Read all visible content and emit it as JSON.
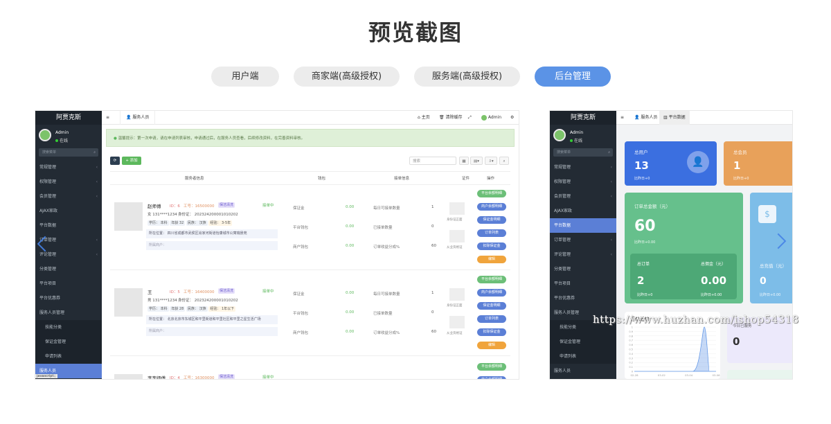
{
  "page_title": "预览截图",
  "tabs": [
    {
      "label": "用户端",
      "active": false
    },
    {
      "label": "商家端(高级授权)",
      "active": false
    },
    {
      "label": "服务端(高级授权)",
      "active": false
    },
    {
      "label": "后台管理",
      "active": true
    }
  ],
  "colors": {
    "accent": "#5b93e6",
    "sidebar": "#232b34",
    "green": "#5cb85c",
    "purple": "#5b7fd6",
    "orange": "#f0a43c"
  },
  "sidebar": {
    "brand": "阿贾克斯",
    "user": "Admin",
    "status": "在线",
    "search_placeholder": "搜索菜单",
    "left_items": [
      "常规管理",
      "权限管理",
      "会员管理",
      "AJAX家政",
      "平台数据",
      "订单管理",
      "评论管理",
      "分类管理",
      "平台项目",
      "平台优惠券",
      "服务人员管理",
      "技能分类",
      "保证金管理",
      "申请列表",
      "服务人员"
    ],
    "right_items": [
      "常规管理",
      "权限管理",
      "会员管理",
      "AJAX家政",
      "平台数据",
      "订单管理",
      "评论管理",
      "分类管理",
      "平台项目",
      "平台优惠券",
      "服务人员管理",
      "技能分类",
      "保证金管理",
      "申请列表",
      "服务人员"
    ]
  },
  "left_screen": {
    "tab": "服务人员",
    "top_links": [
      "主页",
      "清除缓存",
      "Admin"
    ],
    "notice": "温馨提示：第一次申请，请在申请列表审核，申请通过后，在服务人员查看，后续修改资料，在完善资料审核。",
    "add_button": "+ 添加",
    "search_placeholder": "搜索",
    "columns": [
      "服务者信息",
      "钱包",
      "接单信息",
      "证件",
      "操作"
    ],
    "rows": [
      {
        "name": "赵师傅",
        "id": "ID：6",
        "work_no": "工号：16500000",
        "status_tag": "保洁清洗",
        "state": "接单中",
        "gender_phone": "女  131****1234",
        "idcard": "身份证：  2023242000010102​02",
        "edu": "学历：  本科",
        "age": "年龄  32",
        "nation": "民族：  汉族",
        "exp": "经验：  3-5年",
        "address": "所在位置：  四川省成都市武侯区肖家河街道怡康城市公寓瑞景苑",
        "merchant": "所属商户：",
        "wallet": [
          [
            "保证金",
            "0.00"
          ],
          [
            "平台钱包",
            "0.00"
          ],
          [
            "商户钱包",
            "0.00"
          ]
        ],
        "orders": [
          [
            "每日可接单数量",
            "1"
          ],
          [
            "已接单数量",
            "0"
          ],
          [
            "订单收益分成%",
            "60"
          ]
        ],
        "docs": [
          "身份证正面",
          "从业资格证"
        ]
      },
      {
        "name": "王",
        "id": "ID：5",
        "work_no": "工号：16400000",
        "status_tag": "保洁清洗",
        "state": "接单中",
        "gender_phone": "男  131****1234",
        "idcard": "身份证：  2023242000010102​02",
        "edu": "学历：  本科",
        "age": "年龄  28",
        "nation": "民族：  汉族",
        "exp": "经验：  1年以下",
        "address": "所在位置：  北京北京市东城区和平里街道和平里社区和平里之星生活广场",
        "merchant": "所属商户：",
        "wallet": [
          [
            "保证金",
            "0.00"
          ],
          [
            "平台钱包",
            "0.00"
          ],
          [
            "商户钱包",
            "0.00"
          ]
        ],
        "orders": [
          [
            "每日可接单数量",
            "1"
          ],
          [
            "已接单数量",
            "0"
          ],
          [
            "订单收益分成%",
            "60"
          ]
        ],
        "docs": [
          "身份证正面",
          "从业资格证"
        ]
      },
      {
        "name": "李李师傅",
        "id": "ID：4",
        "work_no": "工号：16300000",
        "status_tag": "保洁清洗",
        "state": "接单中"
      }
    ],
    "actions": [
      "平台余额明细",
      "商户余额明细",
      "保证金明细",
      "订单列表",
      "扣除保证金",
      "编辑"
    ],
    "footer": "javascript:;"
  },
  "right_screen": {
    "tabs": [
      "服务人员",
      "平台数据"
    ],
    "cards": [
      {
        "label": "总用户",
        "value": "13",
        "sub": "比昨日+0"
      },
      {
        "label": "总会员",
        "value": "1",
        "sub": "比昨日+0"
      },
      {
        "label": "订单总金额（元）",
        "value": "60",
        "sub": "比昨日+0.00"
      },
      {
        "label": "总订单",
        "value": "2",
        "sub": "比昨日+0"
      },
      {
        "label": "总佣金（元）",
        "value": "0.00",
        "sub": "比昨日+0.00"
      },
      {
        "label": "总充值（元）",
        "value": "0",
        "sub": "比昨日+0.00"
      },
      {
        "label": "今日已服务",
        "value": "0"
      }
    ],
    "chart_title": "订单趋势",
    "chart_data": {
      "type": "area",
      "x": [
        "02-28",
        "03-02",
        "03-04",
        "03-06"
      ],
      "series": [
        {
          "values": [
            0,
            0,
            0,
            0,
            0,
            0,
            1,
            0
          ]
        }
      ],
      "y_ticks": [
        "1",
        "0.9",
        "0.8",
        "0.7",
        "0.6",
        "0.5",
        "0.4",
        "0.3",
        "0.2",
        "0.1",
        "0"
      ],
      "ylim": [
        0,
        1
      ]
    }
  },
  "watermark": "https://www.huzhan.com/ishop54318"
}
